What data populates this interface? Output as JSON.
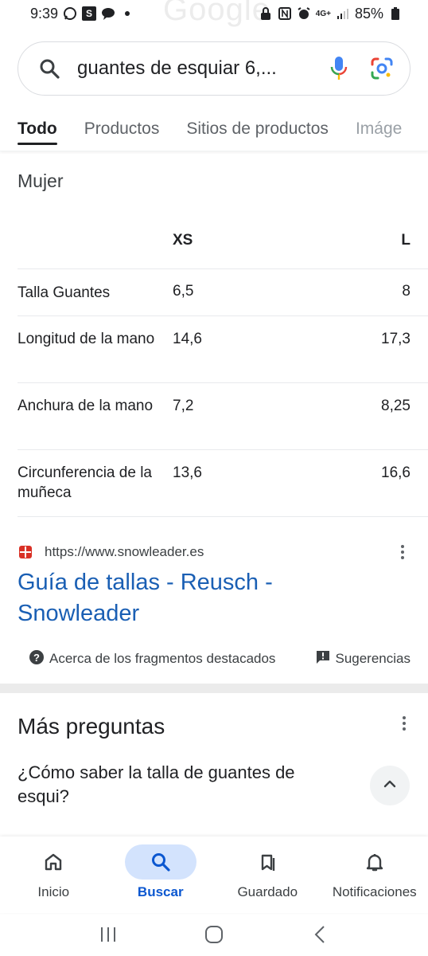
{
  "status_bar": {
    "time": "9:39",
    "battery": "85%",
    "network": "4G+",
    "watermark": "Google"
  },
  "search": {
    "query": "guantes de esquiar 6,..."
  },
  "tabs": [
    {
      "label": "Todo",
      "active": true
    },
    {
      "label": "Productos",
      "active": false
    },
    {
      "label": "Sitios de productos",
      "active": false
    },
    {
      "label": "Imáge",
      "active": false
    }
  ],
  "size_guide": {
    "section_title": "Mujer",
    "columns": [
      "",
      "XS",
      "L"
    ],
    "rows": [
      {
        "label": "Talla Guantes",
        "xs": "6,5",
        "l": "8"
      },
      {
        "label": "Longitud de la mano",
        "xs": "14,6",
        "l": "17,3"
      },
      {
        "label": "Anchura de la mano",
        "xs": "7,2",
        "l": "8,25"
      },
      {
        "label": "Circunferencia de la muñeca",
        "xs": "13,6",
        "l": "16,6"
      }
    ]
  },
  "result": {
    "url": "https://www.snowleader.es",
    "title": "Guía de tallas - Reusch - Snowleader"
  },
  "feedback": {
    "about_label": "Acerca de los fragmentos destacados",
    "suggestions_label": "Sugerencias"
  },
  "more_questions": {
    "title": "Más preguntas",
    "question": "¿Cómo saber la talla de guantes de esqui?"
  },
  "bottom_nav": [
    {
      "label": "Inicio",
      "icon": "home-icon",
      "active": false
    },
    {
      "label": "Buscar",
      "icon": "search-icon",
      "active": true
    },
    {
      "label": "Guardado",
      "icon": "bookmarks-icon",
      "active": false
    },
    {
      "label": "Notificaciones",
      "icon": "bell-icon",
      "active": false
    }
  ],
  "colors": {
    "link": "#1a5fb4",
    "active_nav": "#0b57d0",
    "active_nav_bg": "#d3e3fd"
  }
}
